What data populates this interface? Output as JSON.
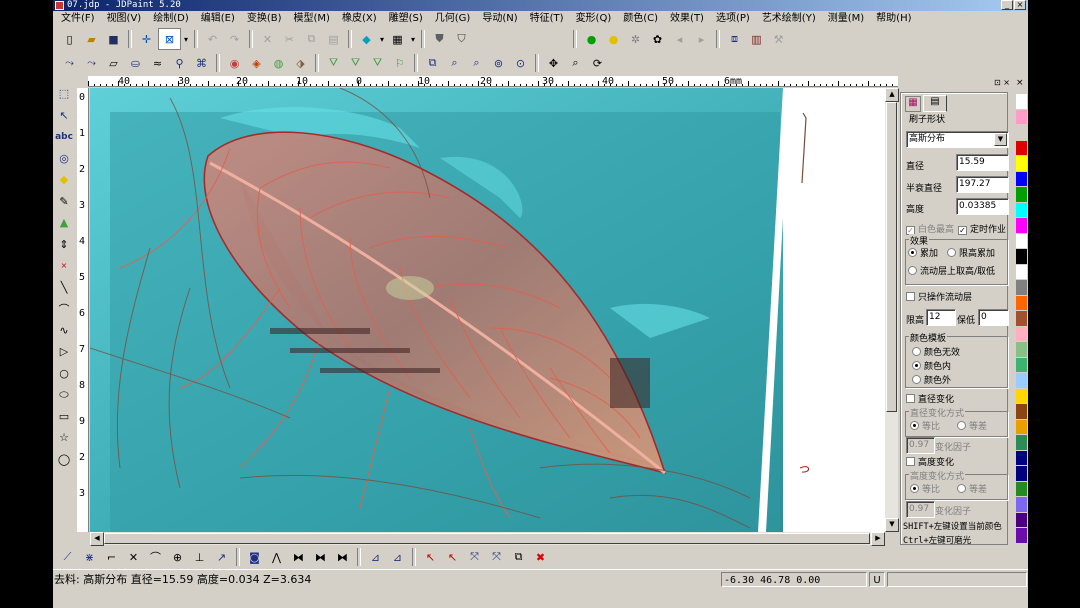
{
  "window": {
    "title": "07.jdp - JDPaint 5.20",
    "controls": [
      "_",
      "□",
      "×"
    ]
  },
  "menu": [
    "文件(F)",
    "视图(V)",
    "绘制(D)",
    "编辑(E)",
    "变换(B)",
    "模型(M)",
    "橡皮(X)",
    "雕塑(S)",
    "几何(G)",
    "导动(N)",
    "特征(T)",
    "変形(Q)",
    "颜色(C)",
    "效果(T)",
    "选项(P)",
    "艺术绘制(Y)",
    "测量(M)",
    "帮助(H)"
  ],
  "ruler": {
    "h_labels": [
      "40",
      "30",
      "20",
      "10",
      "0",
      "10",
      "20",
      "30",
      "40",
      "50",
      "6mm"
    ],
    "v_labels": [
      "0",
      "1",
      "2",
      "3",
      "4",
      "5",
      "6",
      "7",
      "8",
      "9",
      "2",
      "3"
    ]
  },
  "panel": {
    "tab_icons": [
      "brush-tab-icon",
      "page-tab-icon"
    ],
    "brush_shape_label": "刷子形状",
    "brush_shape_value": "高斯分布",
    "diameter_label": "直径",
    "diameter_value": "15.59",
    "half_diameter_label": "半衰直径",
    "half_diameter_value": "197.27",
    "height_label": "高度",
    "height_value": "0.03385",
    "white_max_label": "白色最高",
    "timed_label": "定时作业",
    "effect_group": "效果",
    "effect_add": "累加",
    "effect_limit": "限高累加",
    "effect_flow": "流动层上取高/取低",
    "only_flow_label": "只操作流动层",
    "limit_high_label": "限高",
    "limit_high_value": "12",
    "limit_low_label": "保低",
    "limit_low_value": "0",
    "color_mask_group": "颜色模板",
    "color_none": "颜色无效",
    "color_in": "颜色内",
    "color_out": "颜色外",
    "diam_change_label": "直径变化",
    "diam_mode_group": "直径变化方式",
    "ratio": "等比",
    "diff": "等差",
    "factor1_value": "0.97",
    "factor_label": "变化因子",
    "height_change_label": "高度变化",
    "height_mode_group": "高度变化方式",
    "factor2_value": "0.97",
    "hint1": "SHIFT+左键设置当前颜色",
    "hint2": "Ctrl+左键可磨光"
  },
  "palette": [
    "#ffffff",
    "#ff9cc8",
    "#d4d0c8",
    "#e00000",
    "#ffff00",
    "#0000ff",
    "#00a000",
    "#00ffff",
    "#ff00ff",
    "#ffffff",
    "#000000",
    "#ffffff",
    "#808080",
    "#ff6600",
    "#a0522d",
    "#ffb0c0",
    "#88c088",
    "#3cb371",
    "#99ccff",
    "#ffd700",
    "#8b4513",
    "#e8a000",
    "#2e8b57",
    "#000080",
    "#000080",
    "#228b22",
    "#7b68ee",
    "#4b0082",
    "#6a0dad"
  ],
  "status": {
    "left": "去料: 高斯分布  直径=15.59  高度=0.034  Z=3.634",
    "coords": "-6.30 46.78 0.00",
    "mode": "U"
  }
}
